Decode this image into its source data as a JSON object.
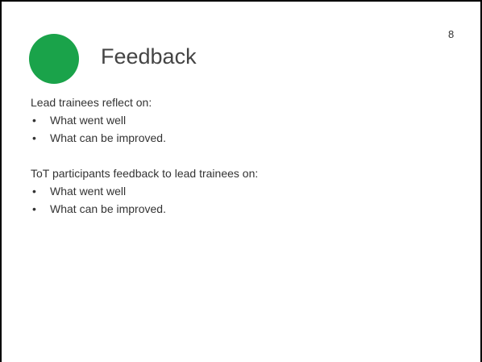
{
  "slide": {
    "title": "Feedback",
    "page_number": "8",
    "accent_color": "#1aa34a",
    "icon": "green-circle-icon"
  },
  "content": {
    "sections": [
      {
        "heading": "Lead trainees reflect on:",
        "bullets": [
          "What went well",
          "What can be improved."
        ]
      },
      {
        "heading": "ToT participants feedback to lead trainees on:",
        "bullets": [
          "What went well",
          "What can be improved."
        ]
      }
    ],
    "bullet_symbol": "•"
  }
}
